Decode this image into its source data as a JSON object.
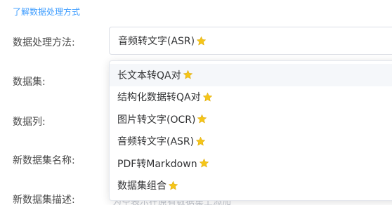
{
  "help_link": "了解数据处理方式",
  "form": {
    "method_label": "数据处理方法:",
    "dataset_label": "数据集:",
    "column_label": "数据列:",
    "new_name_label": "新数据集名称:",
    "new_desc_label": "新数据集描述:",
    "method_value": "音频转文字(ASR)",
    "new_desc_placeholder": "为空表示在原有数据集上添加"
  },
  "dropdown": {
    "options": [
      {
        "label": "长文本转QA对",
        "icon": "star-icon"
      },
      {
        "label": "结构化数据转QA对",
        "icon": "star-icon"
      },
      {
        "label": "图片转文字(OCR)",
        "icon": "star-icon"
      },
      {
        "label": "音频转文字(ASR)",
        "icon": "star-icon"
      },
      {
        "label": "PDF转Markdown",
        "icon": "star-icon"
      },
      {
        "label": "数据集组合",
        "icon": "star-icon"
      }
    ],
    "hovered_index": 0
  },
  "colors": {
    "link": "#409eff",
    "star": "#f5c518",
    "hover_bg": "#f5f7fa"
  }
}
